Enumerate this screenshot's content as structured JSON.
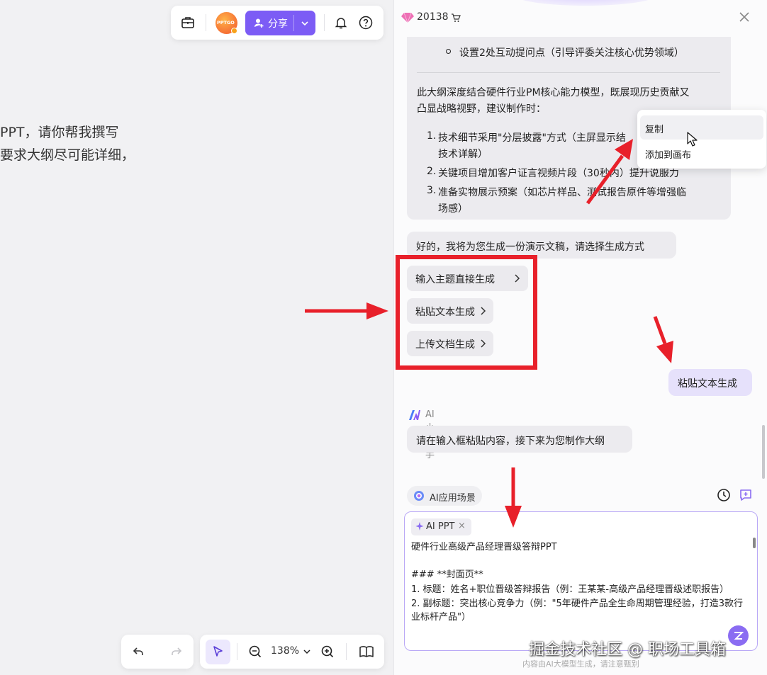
{
  "canvas": {
    "text_lines": [
      "PPT，请你帮我撰写",
      "要求大纲尽可能详细，"
    ],
    "top_toolbar": {
      "avatar_text": "PPTGO",
      "share_label": "分享"
    },
    "bottom_toolbar": {
      "zoom_label": "138%"
    }
  },
  "panel": {
    "credits": "20138",
    "ai_message": {
      "bullet_item": "设置2处互动提问点（引导评委关注核心优势领域）",
      "summary_line1": "此大纲深度结合硬件行业PM核心能力模型，既展现历史贡献又",
      "summary_line2": "凸显战略视野，建议制作时：",
      "tips": [
        {
          "num": "1.",
          "line1": "技术细节采用\"分层披露\"方式（主屏显示结",
          "line2": "技术详解）"
        },
        {
          "num": "2.",
          "line1": "关键项目增加客户证言视频片段（30秒内）提升说服力",
          "line2": ""
        },
        {
          "num": "3.",
          "line1": "准备实物展示预案（如芯片样品、测试报告原件等增强临",
          "line2": "场感）"
        }
      ]
    },
    "generate_prompt": "好的，我将为您生成一份演示文稿，请选择生成方式",
    "options": [
      "输入主题直接生成",
      "粘贴文本生成",
      "上传文档生成"
    ],
    "user_message": "粘贴文本生成",
    "assistant_name": "AI小助手",
    "assistant_reply": "请在输入框粘贴内容，接下来为您制作大纲",
    "scene_chip": "AI应用场景",
    "input": {
      "tag": "AI PPT",
      "lines": [
        "硬件行业高级产品经理晋级答辩PPT",
        "",
        "### **封面页**",
        "1. 标题：姓名+职位晋级答辩报告（例：王某某-高级产品经理晋级述职报告）",
        "2. 副标题：突出核心竞争力（例：\"5年硬件产品全生命周期管理经验，打造3款行",
        "业标杆产品\"）"
      ]
    },
    "footer_note": "内容由AI大模型生成，请注意甄别",
    "context_menu": [
      "复制",
      "添加到画布"
    ]
  },
  "watermark": "掘金技术社区 @ 职场工具箱",
  "colors": {
    "accent": "#7c5cf5",
    "annotation_red": "#e8202a",
    "user_bubble": "#e6e1fb"
  }
}
